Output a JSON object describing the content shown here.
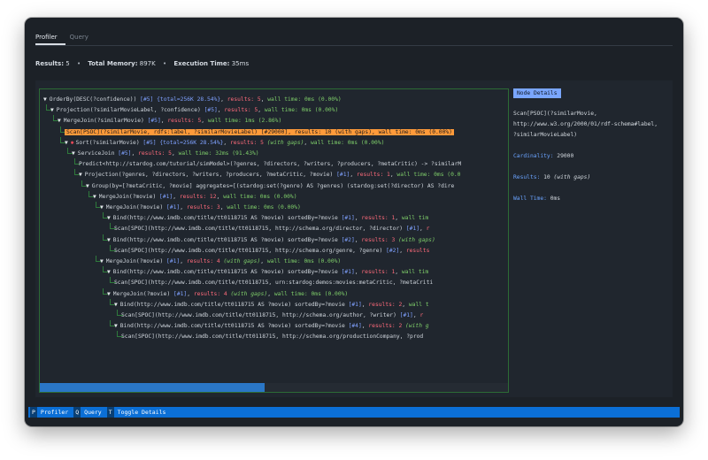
{
  "tabs": [
    {
      "label": "Profiler"
    },
    {
      "label": "Query"
    }
  ],
  "stats": {
    "results_label": "Results:",
    "results_value": "5",
    "memory_label": "Total Memory:",
    "memory_value": "897K",
    "time_label": "Execution Time:",
    "time_value": "35ms",
    "separator": "•"
  },
  "tree_rows": [
    {
      "depth": 0,
      "toggle": "▼",
      "parts": [
        {
          "t": "OrderBy(DESC(?confidence)) "
        },
        {
          "t": "[#5]",
          "c": "bl"
        },
        {
          "t": " {total=256K 28.54%}",
          "c": "bl"
        },
        {
          "t": ", "
        },
        {
          "t": "results: 5",
          "c": "rd"
        },
        {
          "t": ", "
        },
        {
          "t": "wall time: 0ms (0.00%)",
          "c": "gr"
        }
      ]
    },
    {
      "depth": 1,
      "toggle": "▼",
      "parts": [
        {
          "t": "Projection(?similarMovieLabel, ?confidence) "
        },
        {
          "t": "[#5]",
          "c": "bl"
        },
        {
          "t": ", "
        },
        {
          "t": "results: 5",
          "c": "rd"
        },
        {
          "t": ", "
        },
        {
          "t": "wall time: 0ms (0.00%)",
          "c": "gr"
        }
      ]
    },
    {
      "depth": 2,
      "toggle": "▼",
      "parts": [
        {
          "t": "MergeJoin(?similarMovie) "
        },
        {
          "t": "[#5]",
          "c": "bl"
        },
        {
          "t": ", "
        },
        {
          "t": "results: 5",
          "c": "rd"
        },
        {
          "t": ", "
        },
        {
          "t": "wall time: 1ms (2.86%)",
          "c": "gr"
        }
      ]
    },
    {
      "depth": 3,
      "toggle": "",
      "highlight": true,
      "parts": [
        {
          "t": "Scan[PSOC](?similarMovie, rdfs:label, ?similarMovieLabel) [#29000], results: 10 (with gaps), wall time: 0ms (0.00%)"
        }
      ]
    },
    {
      "depth": 3,
      "toggle": "▼",
      "star": "✱",
      "parts": [
        {
          "t": "Sort(?similarMovie) "
        },
        {
          "t": "[#5]",
          "c": "bl"
        },
        {
          "t": " {total=256K 28.54%}",
          "c": "bl"
        },
        {
          "t": ", "
        },
        {
          "t": "results: 5 ",
          "c": "rd"
        },
        {
          "t": "(with gaps)",
          "c": "gi"
        },
        {
          "t": ", "
        },
        {
          "t": "wall time: 0ms (0.00%)",
          "c": "gr"
        }
      ]
    },
    {
      "depth": 4,
      "toggle": "▼",
      "parts": [
        {
          "t": "ServiceJoin "
        },
        {
          "t": "[#5]",
          "c": "bl"
        },
        {
          "t": ", "
        },
        {
          "t": "results: 5",
          "c": "rd"
        },
        {
          "t": ", "
        },
        {
          "t": "wall time: 32ms (91.43%)",
          "c": "gr"
        }
      ]
    },
    {
      "depth": 5,
      "toggle": "",
      "parts": [
        {
          "t": "Predict<http://stardog.com/tutorial/simModel>(?genres, ?directors, ?writers, ?producers, ?metaCritic) -> ?similarM"
        }
      ]
    },
    {
      "depth": 5,
      "toggle": "▼",
      "parts": [
        {
          "t": "Projection(?genres, ?directors, ?writers, ?producers, ?metaCritic, ?movie) "
        },
        {
          "t": "[#1]",
          "c": "bl"
        },
        {
          "t": ", "
        },
        {
          "t": "results: 1",
          "c": "rd"
        },
        {
          "t": ", "
        },
        {
          "t": "wall time: 0ms (0.0",
          "c": "gr"
        }
      ]
    },
    {
      "depth": 6,
      "toggle": "▼",
      "parts": [
        {
          "t": "Group(by=[?metaCritic, ?movie] aggregates=[(stardog:set(?genre) AS ?genres) (stardog:set(?director) AS ?dire"
        }
      ]
    },
    {
      "depth": 7,
      "toggle": "▼",
      "parts": [
        {
          "t": "MergeJoin(?movie) "
        },
        {
          "t": "[#1]",
          "c": "bl"
        },
        {
          "t": ", "
        },
        {
          "t": "results: 12",
          "c": "rd"
        },
        {
          "t": ", "
        },
        {
          "t": "wall time: 0ms (0.00%)",
          "c": "gr"
        }
      ]
    },
    {
      "depth": 8,
      "toggle": "▼",
      "parts": [
        {
          "t": "MergeJoin(?movie) "
        },
        {
          "t": "[#1]",
          "c": "bl"
        },
        {
          "t": ", "
        },
        {
          "t": "results: 3",
          "c": "rd"
        },
        {
          "t": ", "
        },
        {
          "t": "wall time: 0ms (0.00%)",
          "c": "gr"
        }
      ]
    },
    {
      "depth": 9,
      "toggle": "▼",
      "parts": [
        {
          "t": "Bind(http://www.imdb.com/title/tt0118715 AS ?movie) sortedBy=?movie "
        },
        {
          "t": "[#1]",
          "c": "bl"
        },
        {
          "t": ", "
        },
        {
          "t": "results: 1",
          "c": "rd"
        },
        {
          "t": ", "
        },
        {
          "t": "wall tim",
          "c": "gr"
        }
      ]
    },
    {
      "depth": 10,
      "toggle": "",
      "parts": [
        {
          "t": "Scan[SPOC](http://www.imdb.com/title/tt0118715, http://schema.org/director, ?director) "
        },
        {
          "t": "[#1]",
          "c": "bl"
        },
        {
          "t": ", "
        },
        {
          "t": "r",
          "c": "rd"
        }
      ]
    },
    {
      "depth": 9,
      "toggle": "▼",
      "parts": [
        {
          "t": "Bind(http://www.imdb.com/title/tt0118715 AS ?movie) sortedBy=?movie "
        },
        {
          "t": "[#2]",
          "c": "bl"
        },
        {
          "t": ", "
        },
        {
          "t": "results: 3 ",
          "c": "rd"
        },
        {
          "t": "(with gaps)",
          "c": "gi"
        }
      ]
    },
    {
      "depth": 10,
      "toggle": "",
      "parts": [
        {
          "t": "Scan[SPOC](http://www.imdb.com/title/tt0118715, http://schema.org/genre, ?genre) "
        },
        {
          "t": "[#2]",
          "c": "bl"
        },
        {
          "t": ", "
        },
        {
          "t": "results",
          "c": "rd"
        }
      ]
    },
    {
      "depth": 8,
      "toggle": "▼",
      "parts": [
        {
          "t": "MergeJoin(?movie) "
        },
        {
          "t": "[#1]",
          "c": "bl"
        },
        {
          "t": ", "
        },
        {
          "t": "results: 4 ",
          "c": "rd"
        },
        {
          "t": "(with gaps)",
          "c": "gi"
        },
        {
          "t": ", "
        },
        {
          "t": "wall time: 0ms (0.00%)",
          "c": "gr"
        }
      ]
    },
    {
      "depth": 9,
      "toggle": "▼",
      "parts": [
        {
          "t": "Bind(http://www.imdb.com/title/tt0118715 AS ?movie) sortedBy=?movie "
        },
        {
          "t": "[#1]",
          "c": "bl"
        },
        {
          "t": ", "
        },
        {
          "t": "results: 1",
          "c": "rd"
        },
        {
          "t": ", "
        },
        {
          "t": "wall tim",
          "c": "gr"
        }
      ]
    },
    {
      "depth": 10,
      "toggle": "",
      "parts": [
        {
          "t": "Scan[SPOC](http://www.imdb.com/title/tt0118715, urn:stardog:demos:movies:metaCritic, ?metaCriti"
        }
      ]
    },
    {
      "depth": 9,
      "toggle": "▼",
      "parts": [
        {
          "t": "MergeJoin(?movie) "
        },
        {
          "t": "[#1]",
          "c": "bl"
        },
        {
          "t": ", "
        },
        {
          "t": "results: 4 ",
          "c": "rd"
        },
        {
          "t": "(with gaps)",
          "c": "gi"
        },
        {
          "t": ", "
        },
        {
          "t": "wall time: 0ms (0.00%)",
          "c": "gr"
        }
      ]
    },
    {
      "depth": 10,
      "toggle": "▼",
      "parts": [
        {
          "t": "Bind(http://www.imdb.com/title/tt0118715 AS ?movie) sortedBy=?movie "
        },
        {
          "t": "[#1]",
          "c": "bl"
        },
        {
          "t": ", "
        },
        {
          "t": "results: 2",
          "c": "rd"
        },
        {
          "t": ", "
        },
        {
          "t": "wall t",
          "c": "gr"
        }
      ]
    },
    {
      "depth": 11,
      "toggle": "",
      "parts": [
        {
          "t": "Scan[SPOC](http://www.imdb.com/title/tt0118715, http://schema.org/author, ?writer) "
        },
        {
          "t": "[#1]",
          "c": "bl"
        },
        {
          "t": ", "
        },
        {
          "t": "r",
          "c": "rd"
        }
      ]
    },
    {
      "depth": 10,
      "toggle": "▼",
      "parts": [
        {
          "t": "Bind(http://www.imdb.com/title/tt0118715 AS ?movie) sortedBy=?movie "
        },
        {
          "t": "[#4]",
          "c": "bl"
        },
        {
          "t": ", "
        },
        {
          "t": "results: 2 ",
          "c": "rd"
        },
        {
          "t": "(with g",
          "c": "gi"
        }
      ]
    },
    {
      "depth": 11,
      "toggle": "",
      "parts": [
        {
          "t": "Scan[SPOC](http://www.imdb.com/title/tt0118715, http://schema.org/productionCompany, ?prod"
        }
      ]
    }
  ],
  "scrollbar": {
    "position_fraction": 0.0,
    "visible_fraction": 0.48
  },
  "details": {
    "title": "Node Details",
    "node_lines": [
      "Scan[PSOC](?similarMovie,",
      "http://www.w3.org/2000/01/rdf-schema#label,",
      "?similarMovieLabel)"
    ],
    "cardinality_label": "Cardinality:",
    "cardinality_value": "29000",
    "results_label": "Results:",
    "results_value": "10",
    "results_note": "(with gaps)",
    "walltime_label": "Wall Time:",
    "walltime_value": "0ms"
  },
  "footer": [
    {
      "key": "P",
      "label": "Profiler"
    },
    {
      "key": "Q",
      "label": "Query"
    },
    {
      "key": "T",
      "label": "Toggle Details"
    }
  ],
  "colors": {
    "window_bg": "#1c2127",
    "highlight": "#ff9a3a",
    "footer_bg": "#0b6fd6",
    "details_label": "#6aa3ff",
    "tree_border": "#2c6b35"
  }
}
